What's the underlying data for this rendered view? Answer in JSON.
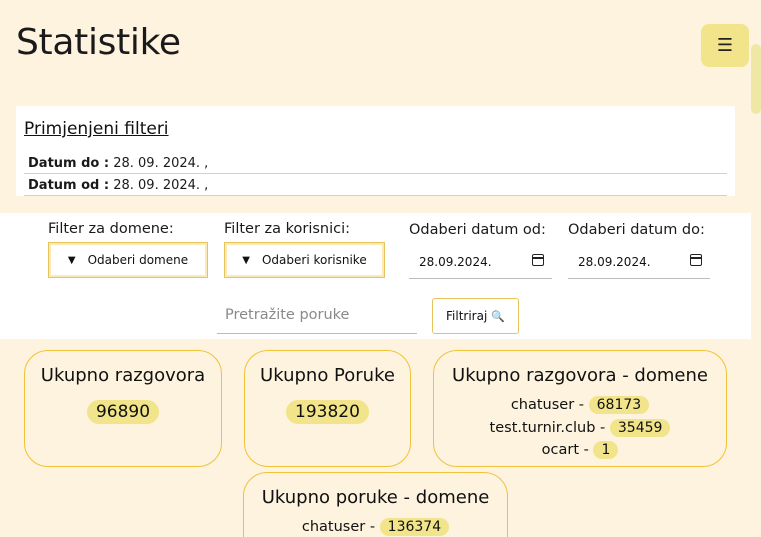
{
  "header": {
    "title": "Statistike",
    "menu_icon": "☰"
  },
  "applied_filters": {
    "title": "Primjenjeni filteri",
    "rows": [
      {
        "label": "Datum do :",
        "value": "28. 09. 2024. ,"
      },
      {
        "label": "Datum od :",
        "value": "28. 09. 2024. ,"
      }
    ]
  },
  "filters": {
    "domain_label": "Filter za domene:",
    "domain_button": "Odaberi domene",
    "user_label": "Filter za korisnici:",
    "user_button": "Odaberi korisnike",
    "date_from_label": "Odaberi datum od:",
    "date_from_value": "28.09.2024.",
    "date_to_label": "Odaberi datum do:",
    "date_to_value": "28.09.2024.",
    "search_placeholder": "Pretražite poruke",
    "submit_label": "Filtriraj"
  },
  "stats": {
    "total_conversations": {
      "title": "Ukupno razgovora",
      "value": "96890"
    },
    "total_messages": {
      "title": "Ukupno Poruke",
      "value": "193820"
    },
    "conversations_by_domain": {
      "title": "Ukupno razgovora - domene",
      "rows": [
        {
          "domain": "chatuser -",
          "count": "68173"
        },
        {
          "domain": "test.turnir.club -",
          "count": "35459"
        },
        {
          "domain": "ocart -",
          "count": "1"
        }
      ]
    },
    "messages_by_domain": {
      "title": "Ukupno poruke - domene",
      "rows": [
        {
          "domain": "chatuser -",
          "count": "136374"
        }
      ]
    }
  },
  "colors": {
    "page_bg": "#fdf3df",
    "accent": "#f1e48a",
    "border": "#f0c23a"
  }
}
